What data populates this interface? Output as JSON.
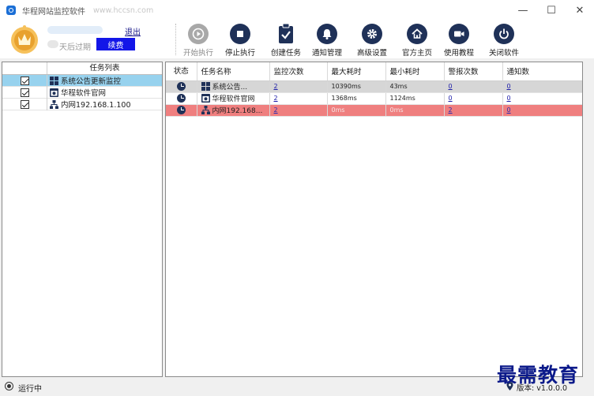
{
  "window": {
    "title": "华程网站监控软件",
    "url": "www.hccsn.com",
    "minimize": "—",
    "maximize": "☐",
    "close": "✕"
  },
  "account": {
    "logout": "退出",
    "expire": "天后过期",
    "renew": "续费"
  },
  "toolbar": [
    {
      "label": "开始执行",
      "icon": "play-icon",
      "enabled": false
    },
    {
      "label": "停止执行",
      "icon": "stop-icon",
      "enabled": true
    },
    {
      "label": "创建任务",
      "icon": "clipboard-check-icon",
      "enabled": true
    },
    {
      "label": "通知管理",
      "icon": "bell-icon",
      "enabled": true
    },
    {
      "label": "高级设置",
      "icon": "gear-icon",
      "enabled": true
    },
    {
      "label": "官方主页",
      "icon": "home-icon",
      "enabled": true
    },
    {
      "label": "使用教程",
      "icon": "video-icon",
      "enabled": true
    },
    {
      "label": "关闭软件",
      "icon": "power-icon",
      "enabled": true
    }
  ],
  "task_list": {
    "header": "任务列表",
    "items": [
      {
        "name": "系统公告更新监控",
        "icon": "grid-icon",
        "checked": true,
        "selected": true
      },
      {
        "name": "华程软件官网",
        "icon": "web-icon",
        "checked": true,
        "selected": false
      },
      {
        "name": "内网192.168.1.100",
        "icon": "network-icon",
        "checked": true,
        "selected": false
      }
    ]
  },
  "monitor_table": {
    "columns": [
      "状态",
      "任务名称",
      "监控次数",
      "最大耗时",
      "最小耗时",
      "警报次数",
      "通知数"
    ],
    "rows": [
      {
        "name": "系统公告...",
        "icon": "grid-icon",
        "count": "2",
        "max": "10390ms",
        "min": "43ms",
        "alerts": "0",
        "notices": "0",
        "style": "gray"
      },
      {
        "name": "华程软件官网",
        "icon": "web-icon",
        "count": "2",
        "max": "1368ms",
        "min": "1124ms",
        "alerts": "0",
        "notices": "0",
        "style": "white"
      },
      {
        "name": "内网192.168...",
        "icon": "network-icon",
        "count": "2",
        "max": "0ms",
        "min": "0ms",
        "alerts": "2",
        "notices": "0",
        "style": "red"
      }
    ]
  },
  "status_bar": {
    "state": "运行中",
    "version": "版本: v1.0.0.0"
  },
  "watermark": "最需教育",
  "colors": {
    "accent": "#1f3158",
    "renew_button": "#1316e8",
    "selected_row": "#97d2ee",
    "alert_row": "#ef7f7f"
  }
}
